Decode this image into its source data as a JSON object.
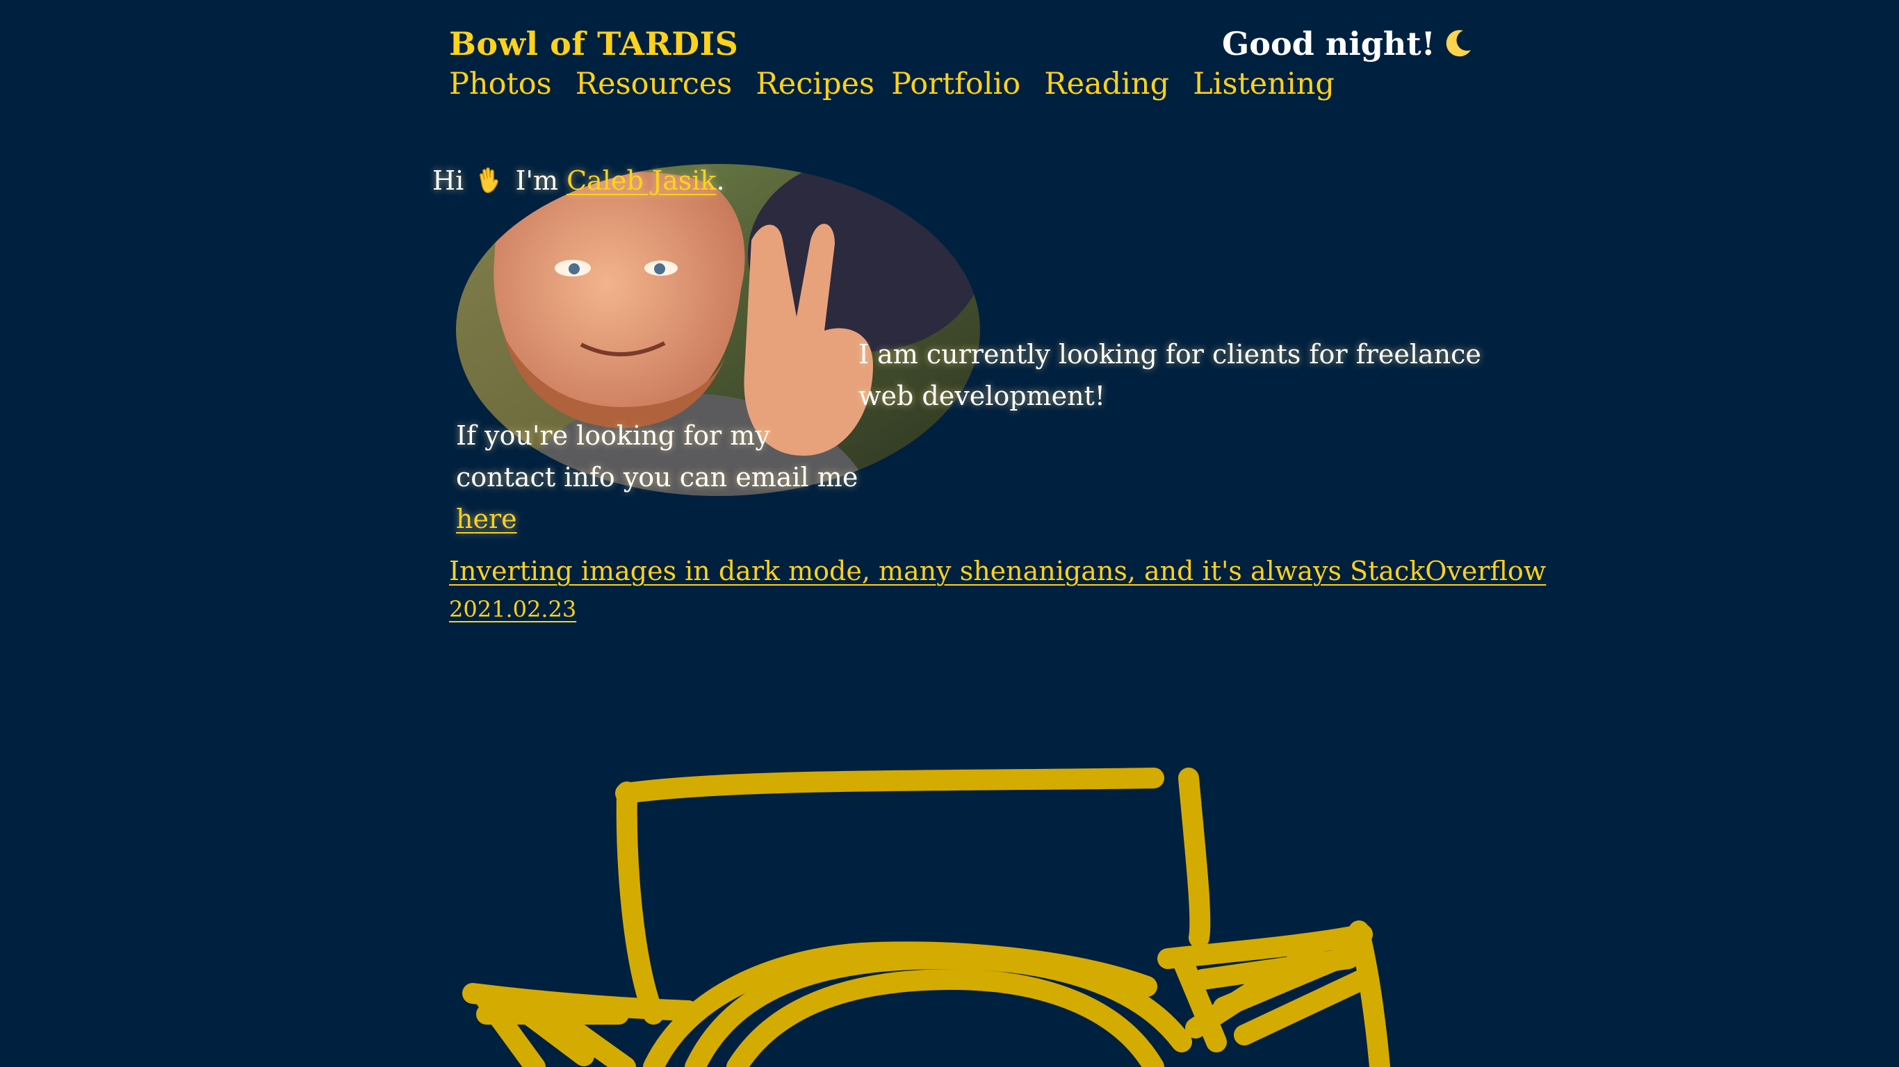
{
  "header": {
    "site_title": "Bowl of TARDIS",
    "greeting": "Good night!",
    "greeting_icon": "crescent-moon-icon"
  },
  "nav": {
    "items": [
      {
        "label": "Photos"
      },
      {
        "label": "Resources"
      },
      {
        "label": "Recipes"
      },
      {
        "label": "Portfolio"
      },
      {
        "label": "Reading"
      },
      {
        "label": "Listening"
      }
    ]
  },
  "intro": {
    "hi": "Hi",
    "wave_icon": "waving-hand-icon",
    "im": "I'm",
    "name_link": "Caleb Jasik",
    "period": "."
  },
  "freelance_text": "I am currently looking for clients for freelance web development!",
  "contact": {
    "text": "If you're looking for my contact info you can email me",
    "link": "here"
  },
  "posts": [
    {
      "title": "Inverting images in dark mode, many shenanigans, and it's always StackOverflow",
      "date": "2021.02.23"
    }
  ],
  "colors": {
    "background": "#00203f",
    "accent": "#ffd21a",
    "drawing": "#d4ab00",
    "text": "#ffffff"
  }
}
